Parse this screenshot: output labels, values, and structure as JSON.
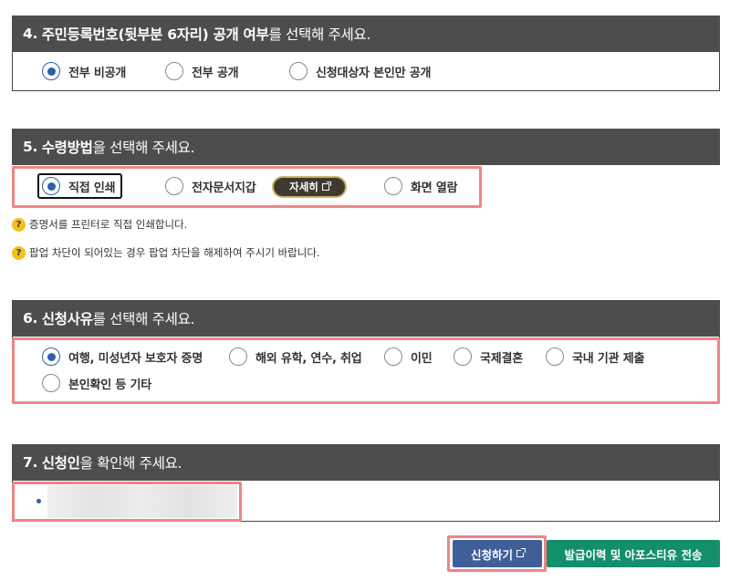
{
  "s4": {
    "number": "4.",
    "title_bold": "주민등록번호(뒷부분 6자리) 공개 여부",
    "title_rest": "를 선택해 주세요.",
    "options": [
      {
        "label": "전부 비공개",
        "selected": true
      },
      {
        "label": "전부 공개",
        "selected": false
      },
      {
        "label": "신청대상자 본인만 공개",
        "selected": false
      }
    ]
  },
  "s5": {
    "number": "5.",
    "title_bold": "수령방법",
    "title_rest": "을 선택해 주세요.",
    "options": [
      {
        "label": "직접 인쇄",
        "selected": true
      },
      {
        "label": "전자문서지갑",
        "selected": false
      },
      {
        "label": "화면 열람",
        "selected": false
      }
    ],
    "detail_button": "자세히",
    "notices": [
      "증명서를 프린터로 직접 인쇄합니다.",
      "팝업 차단이 되어있는 경우 팝업 차단을 해제하여 주시기 바랍니다."
    ]
  },
  "s6": {
    "number": "6.",
    "title_bold": "신청사유",
    "title_rest": "를 선택해 주세요.",
    "options": [
      {
        "label": "여행, 미성년자 보호자 증명",
        "selected": true
      },
      {
        "label": "해외 유학, 연수, 취업",
        "selected": false
      },
      {
        "label": "이민",
        "selected": false
      },
      {
        "label": "국제결혼",
        "selected": false
      },
      {
        "label": "국내 기관 제출",
        "selected": false
      },
      {
        "label": "본인확인 등 기타",
        "selected": false
      }
    ]
  },
  "s7": {
    "number": "7.",
    "title_bold": "신청인",
    "title_rest": "을 확인해 주세요."
  },
  "actions": {
    "apply": "신청하기",
    "history": "발급이력 및 아포스티유 전송"
  },
  "colors": {
    "header_bg": "#4d4d4d",
    "highlight": "#ef8486",
    "radio_selected": "#2f5fa8",
    "apply_bg": "#3f5f98",
    "history_bg": "#138f6c"
  }
}
